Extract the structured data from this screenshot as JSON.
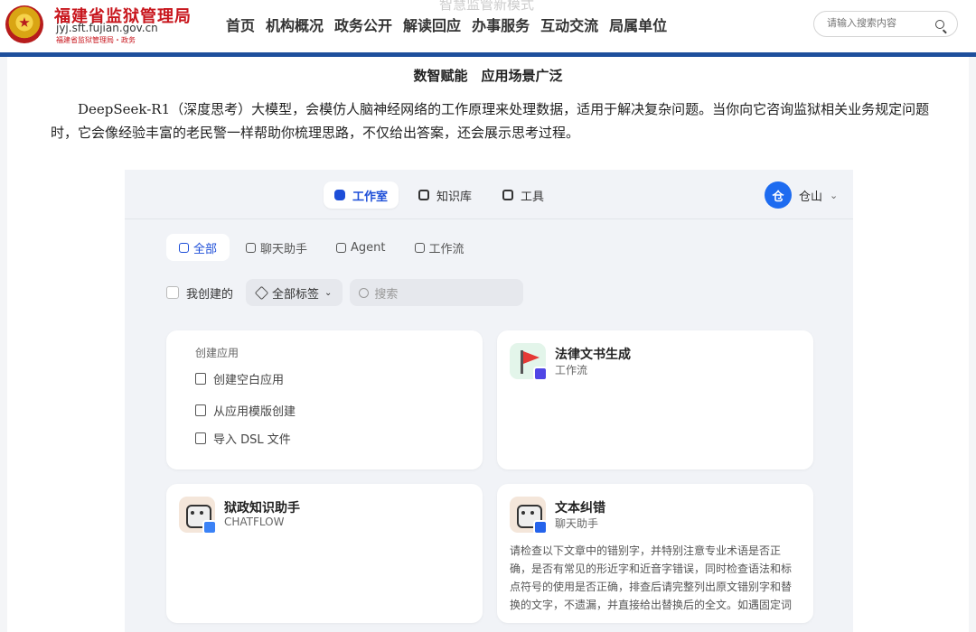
{
  "site": {
    "title": "福建省监狱管理局",
    "domain": "jyj.sft.fujian.gov.cn",
    "subtitle": "福建省监狱管理局・政务",
    "ghost_text": "智慧监管新模式"
  },
  "nav": [
    "首页",
    "机构概况",
    "政务公开",
    "解读回应",
    "办事服务",
    "互动交流",
    "局属单位"
  ],
  "search": {
    "placeholder": "请输入搜索内容"
  },
  "article": {
    "heading": "数智赋能　应用场景广泛",
    "paragraph": "DeepSeek-R1（深度思考）大模型，会模仿人脑神经网络的工作原理来处理数据，适用于解决复杂问题。当你向它咨询监狱相关业务规定问题时，它会像经验丰富的老民警一样帮助你梳理思路，不仅给出答案，还会展示思考过程。"
  },
  "app_ui": {
    "tabs": [
      {
        "label": "工作室",
        "icon": "robot-icon"
      },
      {
        "label": "知识库",
        "icon": "book-icon"
      },
      {
        "label": "工具",
        "icon": "tool-icon"
      }
    ],
    "user": {
      "avatar_text": "仓",
      "name": "仓山",
      "caret": "⌄"
    },
    "filters": [
      {
        "label": "全部",
        "icon": "grid-icon"
      },
      {
        "label": "聊天助手",
        "icon": "chat-icon"
      },
      {
        "label": "Agent",
        "icon": "agent-icon"
      },
      {
        "label": "工作流",
        "icon": "workflow-icon"
      }
    ],
    "my_created": "我创建的",
    "tag_select": "全部标签",
    "tag_caret": "⌄",
    "search_placeholder": "搜索",
    "create_card": {
      "title": "创建应用",
      "items": [
        "创建空白应用",
        "从应用模版创建",
        "导入 DSL 文件"
      ]
    },
    "apps": [
      {
        "name": "法律文书生成",
        "type": "工作流",
        "desc": ""
      },
      {
        "name": "狱政知识助手",
        "type": "CHATFLOW",
        "desc": ""
      },
      {
        "name": "文本纠错",
        "type": "聊天助手",
        "desc": "请检查以下文章中的错别字，并特别注意专业术语是否正确，是否有常见的形近字和近音字错误，同时检查语法和标点符号的使用是否正确，排查后请完整列出原文错别字和替换的文字，不遗漏，并直接给出替换后的全文。如遇固定词语搭配问..."
      }
    ]
  }
}
